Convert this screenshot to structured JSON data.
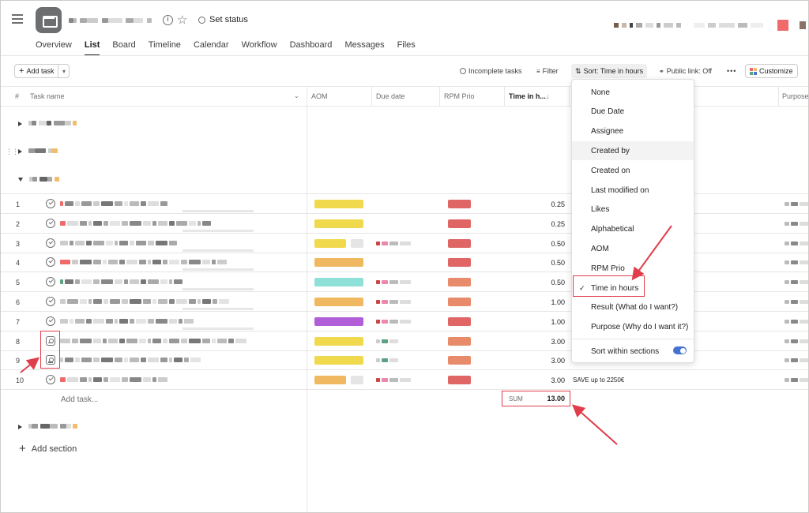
{
  "header": {
    "set_status_label": "Set status",
    "info_icon": "i",
    "star_icon": "☆",
    "tabs": [
      "Overview",
      "List",
      "Board",
      "Timeline",
      "Calendar",
      "Workflow",
      "Dashboard",
      "Messages",
      "Files"
    ],
    "active_tab": "List"
  },
  "toolbar": {
    "add_task_label": "Add task",
    "incomplete_tasks_label": "Incomplete tasks",
    "filter_label": "Filter",
    "sort_label": "Sort: Time in hours",
    "public_link_label": "Public link: Off",
    "more_label": "•••",
    "customize_label": "Customize"
  },
  "columns": {
    "num": "#",
    "task_name": "Task name",
    "aom": "AOM",
    "due_date": "Due date",
    "rpm_prio": "RPM Prio",
    "time_in_hours": "Time in h...",
    "purpose": "Purpose"
  },
  "rows": [
    {
      "num": "1",
      "hours": "0.25",
      "result": "",
      "aom_color": "#f1d94e",
      "rpm_color": "#e06666",
      "due": false
    },
    {
      "num": "2",
      "hours": "0.25",
      "result": "",
      "aom_color": "#f1d94e",
      "rpm_color": "#e06666",
      "due": false
    },
    {
      "num": "3",
      "hours": "0.50",
      "result": "",
      "aom_color": "#f1d94e",
      "rpm_color": "#e06666",
      "due": true
    },
    {
      "num": "4",
      "hours": "0.50",
      "result": "",
      "aom_color": "#f0b860",
      "rpm_color": "#e06666",
      "due": false
    },
    {
      "num": "5",
      "hours": "0.50",
      "result": "",
      "aom_color": "#8fe0d8",
      "rpm_color": "#e88b6b",
      "due": true
    },
    {
      "num": "6",
      "hours": "1.00",
      "result": "",
      "aom_color": "#f0b860",
      "rpm_color": "#e88b6b",
      "due": true
    },
    {
      "num": "7",
      "hours": "1.00",
      "result": "",
      "aom_color": "#b05fd8",
      "rpm_color": "#e06666",
      "due": true
    },
    {
      "num": "8",
      "hours": "3.00",
      "result": "",
      "aom_color": "#f1d94e",
      "rpm_color": "#e88b6b",
      "due": true
    },
    {
      "num": "9",
      "hours": "3.00",
      "result": "",
      "aom_color": "#f1d94e",
      "rpm_color": "#e88b6b",
      "due": true
    },
    {
      "num": "10",
      "hours": "3.00",
      "result": "SAVE up to 2250€",
      "aom_color": "#f0b860",
      "rpm_color": "#e06666",
      "due": true
    }
  ],
  "add_task_inline": "Add task...",
  "sum": {
    "label": "SUM",
    "value": "13.00"
  },
  "add_section_label": "Add section",
  "sort_menu": {
    "items": [
      "None",
      "Due Date",
      "Assignee",
      "Created by",
      "Created on",
      "Last modified on",
      "Likes",
      "Alphabetical",
      "AOM",
      "RPM Prio",
      "Time in hours",
      "Result (What do I want?)",
      "Purpose (Why do I want it?)"
    ],
    "selected": "Time in hours",
    "check_mark": "✓",
    "sort_within_sections_label": "Sort within sections",
    "sort_within_sections_on": true
  },
  "colors": {
    "annotation_red": "#e03e4a",
    "toggle_blue": "#4573d2"
  }
}
